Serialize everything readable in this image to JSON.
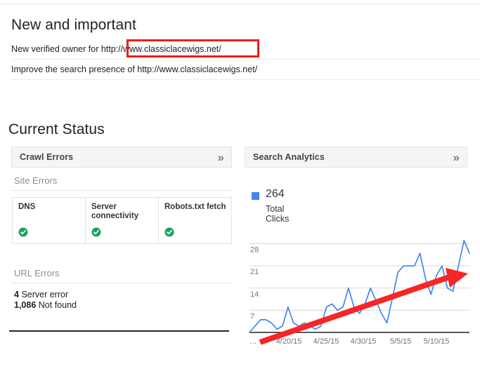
{
  "page": {
    "new_and_important_title": "New and important",
    "current_status_title": "Current Status"
  },
  "notifications": [
    {
      "text": "New verified owner for http://www.classiclacewigs.net/",
      "highlighted": true
    },
    {
      "text": "Improve the search presence of http://www.classiclacewigs.net/",
      "highlighted": false
    }
  ],
  "annotation": {
    "type": "red-rectangle-highlight",
    "color": "#f11b1b",
    "target": "http://www.classiclacewigs.net/"
  },
  "crawl_errors_panel": {
    "header_label": "Crawl Errors",
    "expand_icon": "double-chevron-right-icon",
    "site_errors_label": "Site Errors",
    "site_errors": [
      {
        "name": "DNS",
        "status": "ok",
        "status_icon": "green-check-circle-icon"
      },
      {
        "name": "Server connectivity",
        "status": "ok",
        "status_icon": "green-check-circle-icon"
      },
      {
        "name": "Robots.txt fetch",
        "status": "ok",
        "status_icon": "green-check-circle-icon"
      }
    ],
    "url_errors_label": "URL Errors",
    "url_errors": [
      {
        "count": "4",
        "label": "Server error"
      },
      {
        "count": "1,086",
        "label": "Not found"
      }
    ]
  },
  "search_analytics_panel": {
    "header_label": "Search Analytics",
    "expand_icon": "double-chevron-right-icon",
    "legend_swatch_color": "#4285f4",
    "total_value": "264",
    "total_caption": "Total Clicks"
  },
  "chart_data": {
    "type": "line",
    "title": "",
    "xlabel": "",
    "ylabel": "",
    "series": [
      {
        "name": "Total Clicks",
        "color": "#4285f4",
        "values": [
          0,
          2,
          4,
          4,
          3,
          1,
          2,
          8,
          3,
          2,
          3,
          2,
          1,
          2,
          8,
          9,
          7,
          8,
          14,
          8,
          6,
          9,
          14,
          10,
          6,
          3,
          11,
          19,
          21,
          21,
          21,
          25,
          17,
          12,
          18,
          21,
          14,
          13,
          21,
          29,
          25
        ]
      }
    ],
    "x": [
      "4/15/15",
      "4/16/15",
      "4/17/15",
      "4/18/15",
      "4/19/15",
      "4/20/15",
      "4/21/15",
      "4/22/15",
      "4/23/15",
      "4/24/15",
      "4/25/15",
      "4/26/15",
      "4/27/15",
      "4/28/15",
      "4/29/15",
      "4/30/15",
      "5/1/15",
      "5/2/15",
      "5/3/15",
      "5/4/15",
      "5/5/15",
      "5/6/15",
      "5/7/15",
      "5/8/15",
      "5/9/15",
      "5/10/15",
      "5/11/15",
      "5/12/15"
    ],
    "xtick_labels": [
      "…",
      "4/20/15",
      "4/25/15",
      "4/30/15",
      "5/5/15",
      "5/10/15"
    ],
    "ytick_labels": [
      "7",
      "14",
      "21",
      "28"
    ],
    "ylim": [
      0,
      31
    ],
    "grid": true,
    "legend_position": "above-chart",
    "annotations": [
      {
        "type": "trend-arrow",
        "color": "#f72525",
        "direction": "up-right",
        "from": "bottom-left",
        "to": "top-right"
      }
    ]
  }
}
